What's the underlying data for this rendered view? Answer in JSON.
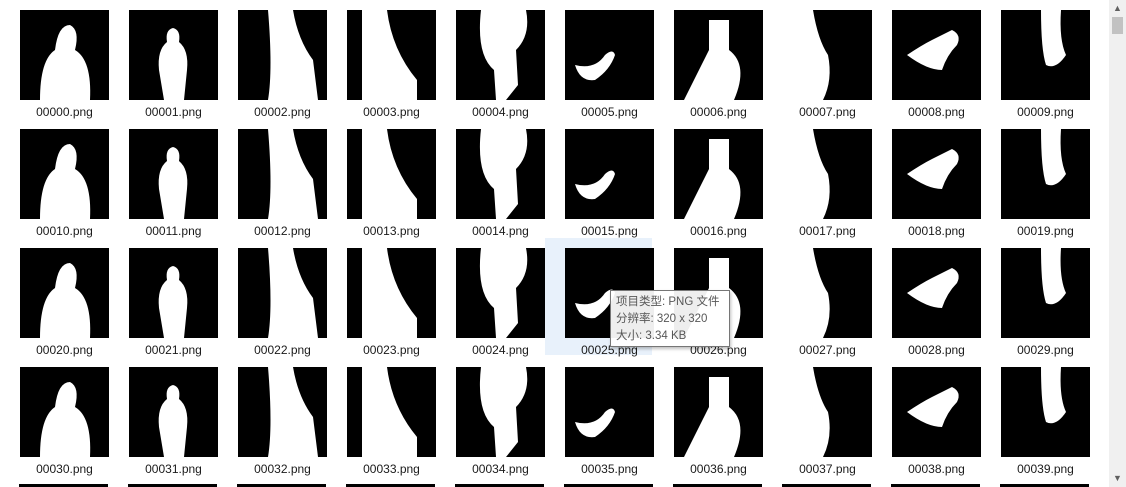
{
  "files": [
    {
      "name": "00000.png"
    },
    {
      "name": "00001.png"
    },
    {
      "name": "00002.png"
    },
    {
      "name": "00003.png"
    },
    {
      "name": "00004.png"
    },
    {
      "name": "00005.png"
    },
    {
      "name": "00006.png"
    },
    {
      "name": "00007.png"
    },
    {
      "name": "00008.png"
    },
    {
      "name": "00009.png"
    },
    {
      "name": "00010.png"
    },
    {
      "name": "00011.png"
    },
    {
      "name": "00012.png"
    },
    {
      "name": "00013.png"
    },
    {
      "name": "00014.png"
    },
    {
      "name": "00015.png"
    },
    {
      "name": "00016.png"
    },
    {
      "name": "00017.png"
    },
    {
      "name": "00018.png"
    },
    {
      "name": "00019.png"
    },
    {
      "name": "00020.png"
    },
    {
      "name": "00021.png"
    },
    {
      "name": "00022.png"
    },
    {
      "name": "00023.png"
    },
    {
      "name": "00024.png"
    },
    {
      "name": "00025.png",
      "selected": true
    },
    {
      "name": "00026.png"
    },
    {
      "name": "00027.png"
    },
    {
      "name": "00028.png"
    },
    {
      "name": "00029.png"
    },
    {
      "name": "00030.png"
    },
    {
      "name": "00031.png"
    },
    {
      "name": "00032.png"
    },
    {
      "name": "00033.png"
    },
    {
      "name": "00034.png"
    },
    {
      "name": "00035.png"
    },
    {
      "name": "00036.png"
    },
    {
      "name": "00037.png"
    },
    {
      "name": "00038.png"
    },
    {
      "name": "00039.png"
    }
  ],
  "tooltip": {
    "type_line": "项目类型: PNG 文件",
    "resolution_line": "分辨率: 320 x 320",
    "size_line": "大小: 3.34 KB"
  },
  "scrollbar": {
    "up_icon": "▲",
    "down_icon": "▼"
  }
}
